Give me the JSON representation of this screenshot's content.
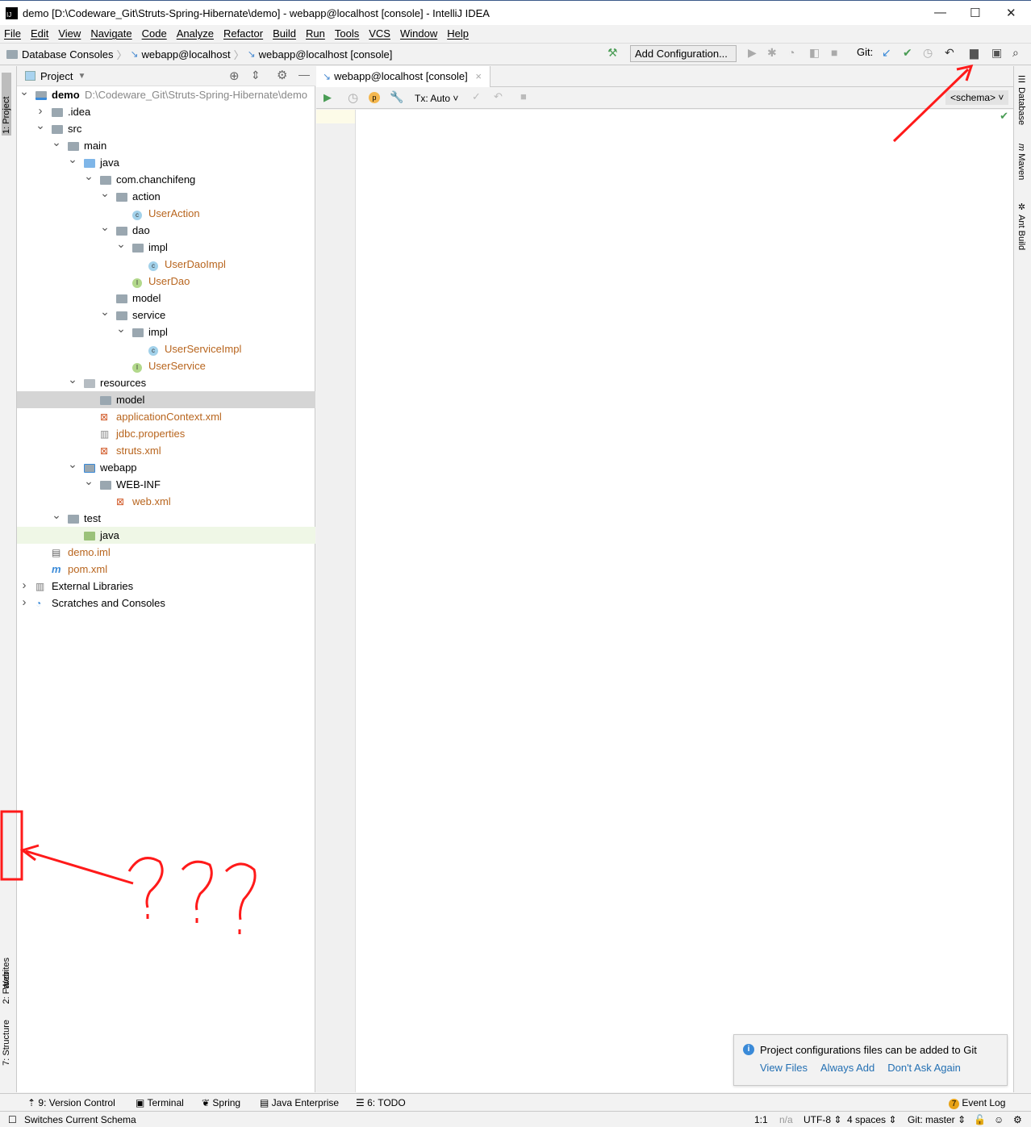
{
  "window": {
    "title": "demo [D:\\Codeware_Git\\Struts-Spring-Hibernate\\demo] - webapp@localhost [console] - IntelliJ IDEA"
  },
  "menu": [
    "File",
    "Edit",
    "View",
    "Navigate",
    "Code",
    "Analyze",
    "Refactor",
    "Build",
    "Run",
    "Tools",
    "VCS",
    "Window",
    "Help"
  ],
  "breadcrumb": [
    "Database Consoles",
    "webapp@localhost",
    "webapp@localhost [console]"
  ],
  "toolbar": {
    "add_config": "Add Configuration...",
    "git_label": "Git:"
  },
  "project": {
    "header": "Project",
    "tree": [
      {
        "d": 0,
        "a": "open",
        "icon": "module",
        "label": "demo",
        "path": "D:\\Codeware_Git\\Struts-Spring-Hibernate\\demo"
      },
      {
        "d": 1,
        "a": "closed",
        "icon": "folder",
        "label": ".idea"
      },
      {
        "d": 1,
        "a": "open",
        "icon": "folder",
        "label": "src"
      },
      {
        "d": 2,
        "a": "open",
        "icon": "folder",
        "label": "main"
      },
      {
        "d": 3,
        "a": "open",
        "icon": "src",
        "label": "java"
      },
      {
        "d": 4,
        "a": "open",
        "icon": "pkg",
        "label": "com.chanchifeng"
      },
      {
        "d": 5,
        "a": "open",
        "icon": "pkg",
        "label": "action"
      },
      {
        "d": 6,
        "a": "",
        "icon": "class",
        "label": "UserAction",
        "orange": true
      },
      {
        "d": 5,
        "a": "open",
        "icon": "pkg",
        "label": "dao"
      },
      {
        "d": 6,
        "a": "open",
        "icon": "pkg",
        "label": "impl"
      },
      {
        "d": 7,
        "a": "",
        "icon": "class",
        "label": "UserDaoImpl",
        "orange": true
      },
      {
        "d": 6,
        "a": "",
        "icon": "iface",
        "label": "UserDao",
        "orange": true
      },
      {
        "d": 5,
        "a": "",
        "icon": "pkg",
        "label": "model"
      },
      {
        "d": 5,
        "a": "open",
        "icon": "pkg",
        "label": "service"
      },
      {
        "d": 6,
        "a": "open",
        "icon": "pkg",
        "label": "impl"
      },
      {
        "d": 7,
        "a": "",
        "icon": "class",
        "label": "UserServiceImpl",
        "orange": true
      },
      {
        "d": 6,
        "a": "",
        "icon": "iface",
        "label": "UserService",
        "orange": true
      },
      {
        "d": 3,
        "a": "open",
        "icon": "res",
        "label": "resources"
      },
      {
        "d": 4,
        "a": "",
        "icon": "pkg",
        "label": "model",
        "sel": true
      },
      {
        "d": 4,
        "a": "",
        "icon": "xml",
        "label": "applicationContext.xml",
        "orange": true
      },
      {
        "d": 4,
        "a": "",
        "icon": "prop",
        "label": "jdbc.properties",
        "orange": true
      },
      {
        "d": 4,
        "a": "",
        "icon": "xml",
        "label": "struts.xml",
        "orange": true
      },
      {
        "d": 3,
        "a": "open",
        "icon": "web",
        "label": "webapp"
      },
      {
        "d": 4,
        "a": "open",
        "icon": "folder",
        "label": "WEB-INF"
      },
      {
        "d": 5,
        "a": "",
        "icon": "xml",
        "label": "web.xml",
        "orange": true
      },
      {
        "d": 2,
        "a": "open",
        "icon": "folder",
        "label": "test"
      },
      {
        "d": 3,
        "a": "",
        "icon": "test",
        "label": "java",
        "green": true
      },
      {
        "d": 1,
        "a": "",
        "icon": "iml",
        "label": "demo.iml",
        "orange": true
      },
      {
        "d": 1,
        "a": "",
        "icon": "maven",
        "label": "pom.xml",
        "orange": true
      },
      {
        "d": 0,
        "a": "closed",
        "icon": "lib",
        "label": "External Libraries"
      },
      {
        "d": 0,
        "a": "closed",
        "icon": "scratch",
        "label": "Scratches and Consoles"
      }
    ]
  },
  "left_tabs": [
    "1: Project",
    "2: Favorites",
    "Web",
    "7: Structure"
  ],
  "right_tabs": [
    "Database",
    "Maven",
    "Ant Build"
  ],
  "editor": {
    "tab": "webapp@localhost [console]",
    "tx": "Tx: Auto",
    "schema": "<schema>"
  },
  "notification": {
    "message": "Project configurations files can be added to Git",
    "actions": [
      "View Files",
      "Always Add",
      "Don't Ask Again"
    ]
  },
  "tool_windows": [
    "9: Version Control",
    "Terminal",
    "Spring",
    "Java Enterprise",
    "6: TODO"
  ],
  "event_log": {
    "count": "7",
    "label": "Event Log"
  },
  "status": {
    "message": "Switches Current Schema",
    "position": "1:1",
    "na": "n/a",
    "encoding": "UTF-8 ⇕",
    "indent": "4 spaces ⇕",
    "git": "Git: master ⇕"
  },
  "annotation": {
    "text": "???",
    "color": "#ff0000"
  }
}
